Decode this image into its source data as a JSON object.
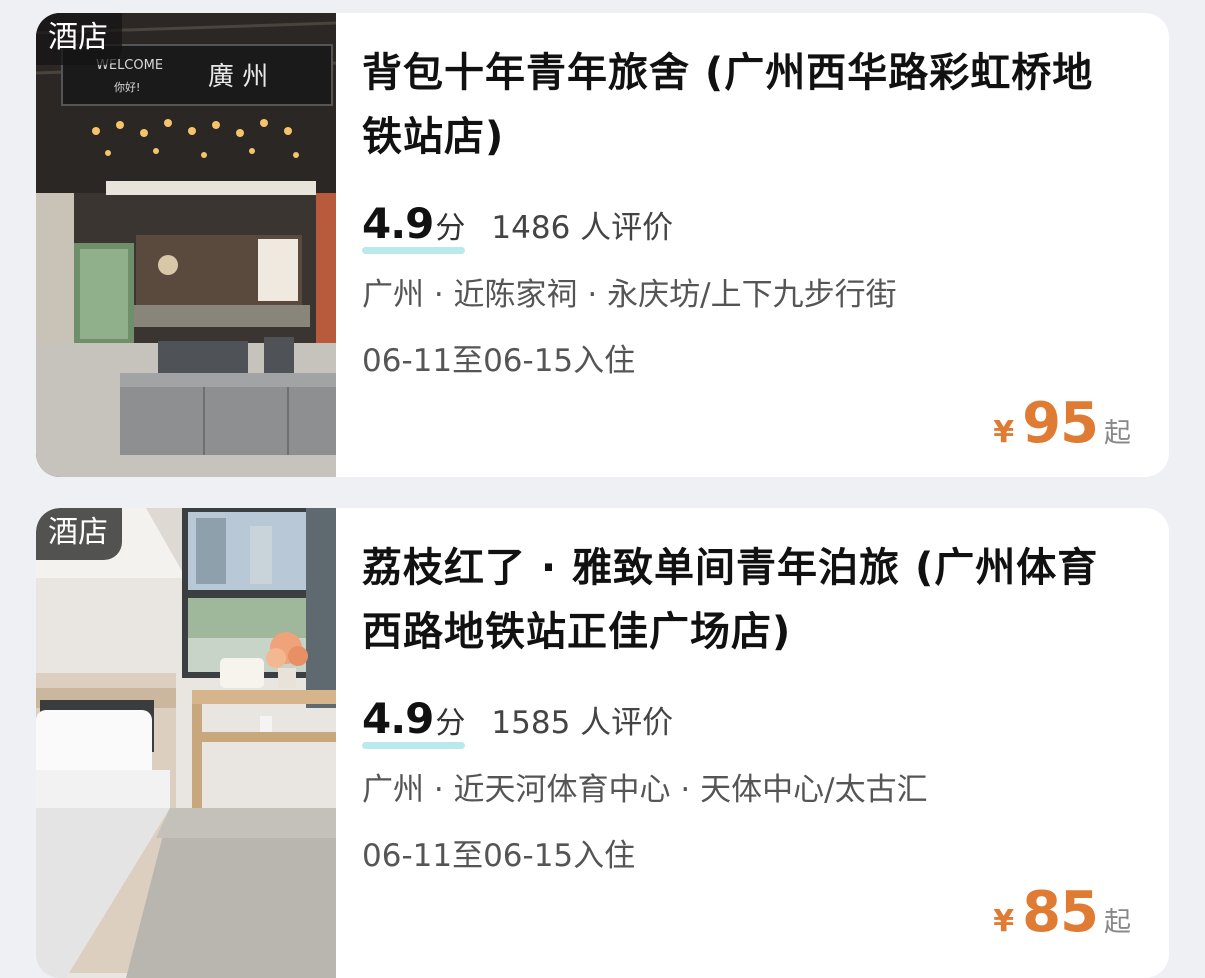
{
  "listings": [
    {
      "tag": "酒店",
      "name": "背包十年青年旅舍 (广州西华路彩虹桥地铁站店)",
      "score": "4.9",
      "score_unit": "分",
      "reviews": "1486 人评价",
      "location": "广州 · 近陈家祠 · 永庆坊/上下九步行街",
      "dates": "06-11至06-15入住",
      "currency": "¥",
      "price": "95",
      "price_suffix": "起",
      "sign_welcome": "WELCOME",
      "sign_hello": "你好!",
      "sign_city": "廣 州"
    },
    {
      "tag": "酒店",
      "name": "荔枝红了 · 雅致单间青年泊旅 (广州体育西路地铁站正佳广场店)",
      "score": "4.9",
      "score_unit": "分",
      "reviews": "1585 人评价",
      "location": "广州 · 近天河体育中心 · 天体中心/太古汇",
      "dates": "06-11至06-15入住",
      "currency": "¥",
      "price": "85",
      "price_suffix": "起"
    }
  ],
  "colors": {
    "page_bg": "#eef0f4",
    "price": "#e07b34",
    "score_underline": "#b9e9ec"
  }
}
